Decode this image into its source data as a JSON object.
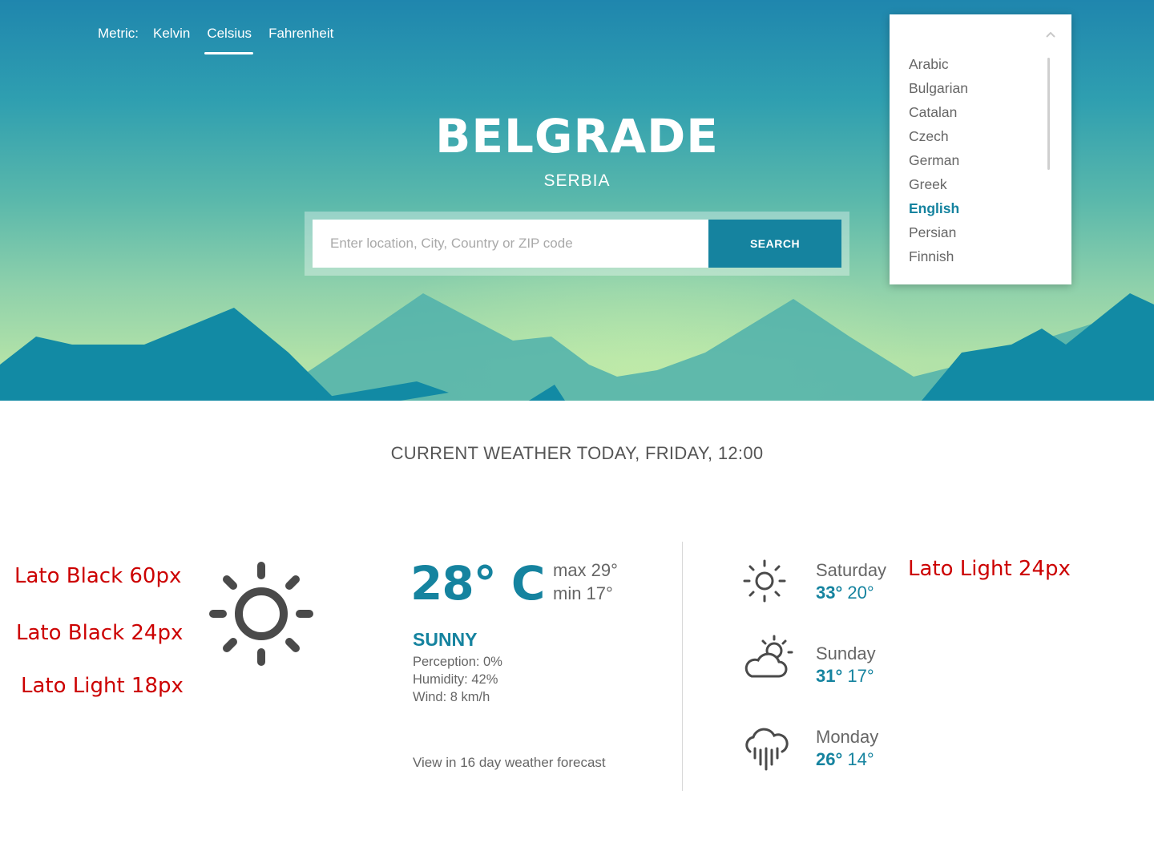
{
  "metric": {
    "label": "Metric:",
    "options": [
      "Kelvin",
      "Celsius",
      "Fahrenheit"
    ],
    "active": "Celsius"
  },
  "location": {
    "city": "BELGRADE",
    "country": "SERBIA"
  },
  "search": {
    "placeholder": "Enter location, City, Country or ZIP code",
    "button": "SEARCH"
  },
  "languages": {
    "items": [
      "Arabic",
      "Bulgarian",
      "Catalan",
      "Czech",
      "German",
      "Greek",
      "English",
      "Persian",
      "Finnish"
    ],
    "selected": "English"
  },
  "current": {
    "title": "CURRENT WEATHER TODAY, FRIDAY, 12:00",
    "temp": "28° C",
    "max": "max 29°",
    "min": "min 17°",
    "condition": "SUNNY",
    "perception": "Perception: 0%",
    "humidity": "Humidity: 42%",
    "wind": "Wind: 8 km/h",
    "icon": "sun-icon",
    "forecast_link": "View in 16 day weather forecast"
  },
  "days": [
    {
      "name": "Saturday",
      "high": "33°",
      "low": "20°",
      "icon": "sun-icon"
    },
    {
      "name": "Sunday",
      "high": "31°",
      "low": "17°",
      "icon": "partly-cloudy-icon"
    },
    {
      "name": "Monday",
      "high": "26°",
      "low": "14°",
      "icon": "rain-icon"
    }
  ],
  "annotations": {
    "lato_black_60": "Lato Black 60px",
    "lato_black_24": "Lato Black 24px",
    "lato_light_18": "Lato Light 18px",
    "lato_light_24": "Lato Light 24px"
  },
  "colors": {
    "accent": "#15839f",
    "annotation": "#cc0000",
    "text": "#666666"
  }
}
